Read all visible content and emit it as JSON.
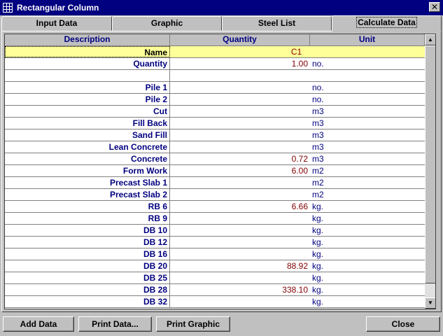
{
  "window": {
    "title": "Rectangular Column",
    "close_glyph": "✕"
  },
  "tabs": [
    {
      "label": "Input Data"
    },
    {
      "label": "Graphic"
    },
    {
      "label": "Steel List"
    },
    {
      "label": "Calculate Data",
      "active": true
    }
  ],
  "grid": {
    "headers": {
      "description": "Description",
      "quantity": "Quantity",
      "unit": "Unit"
    },
    "name_row": {
      "label": "Name",
      "value": "C1"
    },
    "rows": [
      {
        "desc": "Quantity",
        "qty": "1.00",
        "unit": "no."
      },
      {
        "desc": "",
        "qty": "",
        "unit": ""
      },
      {
        "desc": "Pile 1",
        "qty": "",
        "unit": "no."
      },
      {
        "desc": "Pile 2",
        "qty": "",
        "unit": "no."
      },
      {
        "desc": "Cut",
        "qty": "",
        "unit": "m3"
      },
      {
        "desc": "Fill Back",
        "qty": "",
        "unit": "m3"
      },
      {
        "desc": "Sand Fill",
        "qty": "",
        "unit": "m3"
      },
      {
        "desc": "Lean Concrete",
        "qty": "",
        "unit": "m3"
      },
      {
        "desc": "Concrete",
        "qty": "0.72",
        "unit": "m3"
      },
      {
        "desc": "Form Work",
        "qty": "6.00",
        "unit": "m2"
      },
      {
        "desc": "Precast Slab 1",
        "qty": "",
        "unit": "m2"
      },
      {
        "desc": "Precast Slab 2",
        "qty": "",
        "unit": "m2"
      },
      {
        "desc": "RB 6",
        "qty": "6.66",
        "unit": "kg."
      },
      {
        "desc": "RB 9",
        "qty": "",
        "unit": "kg."
      },
      {
        "desc": "DB 10",
        "qty": "",
        "unit": "kg."
      },
      {
        "desc": "DB 12",
        "qty": "",
        "unit": "kg."
      },
      {
        "desc": "DB 16",
        "qty": "",
        "unit": "kg."
      },
      {
        "desc": "DB 20",
        "qty": "88.92",
        "unit": "kg."
      },
      {
        "desc": "DB 25",
        "qty": "",
        "unit": "kg."
      },
      {
        "desc": "DB 28",
        "qty": "338.10",
        "unit": "kg."
      },
      {
        "desc": "DB 32",
        "qty": "",
        "unit": "kg."
      }
    ]
  },
  "scrollbar": {
    "up_glyph": "▲",
    "down_glyph": "▼"
  },
  "buttons": {
    "add_data": "Add Data",
    "print_data": "Print Data...",
    "print_graphic": "Print Graphic",
    "close": "Close"
  },
  "colors": {
    "titlebar": "#000080",
    "name_row": "#ffff99",
    "desc_text": "#000080",
    "qty_text": "#800000"
  }
}
